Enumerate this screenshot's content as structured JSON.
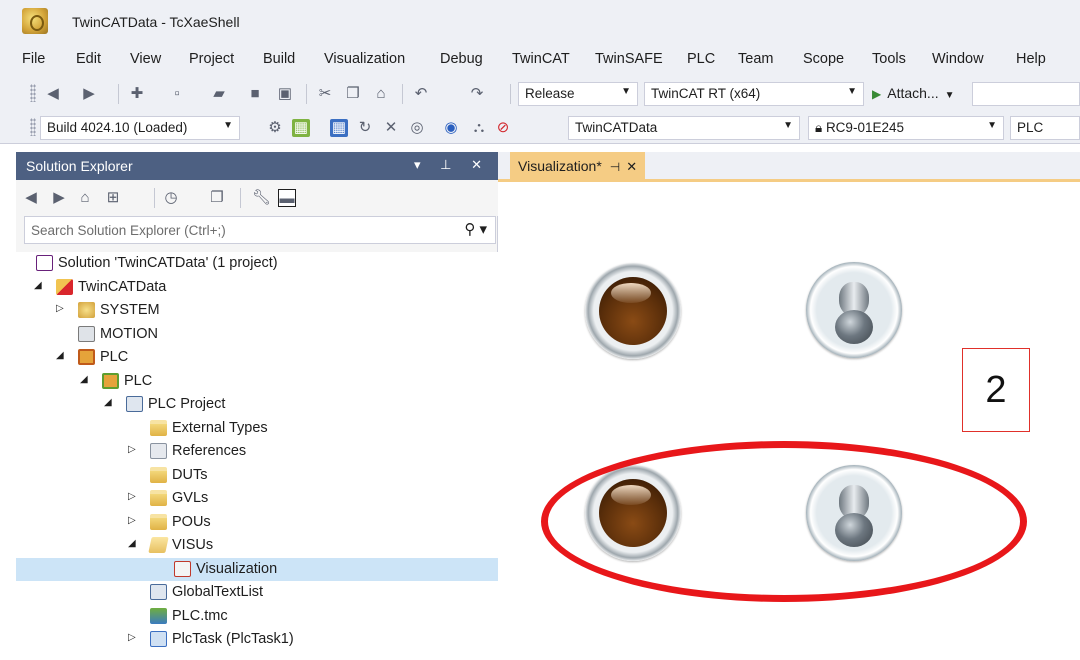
{
  "window": {
    "title": "TwinCATData - TcXaeShell"
  },
  "menu": [
    "File",
    "Edit",
    "View",
    "Project",
    "Build",
    "Visualization",
    "Debug",
    "TwinCAT",
    "TwinSAFE",
    "PLC",
    "Team",
    "Scope",
    "Tools",
    "Window",
    "Help"
  ],
  "toolbar1": {
    "configuration": "Release",
    "platform": "TwinCAT RT (x64)",
    "attach_label": "Attach..."
  },
  "toolbar2": {
    "build": "Build 4024.10 (Loaded)",
    "project": "TwinCATData",
    "target": "RC9-01E245",
    "plc": "PLC"
  },
  "solution_explorer": {
    "title": "Solution Explorer",
    "search_placeholder": "Search Solution Explorer (Ctrl+;)",
    "tree": [
      {
        "label": "Solution 'TwinCATData' (1 project)",
        "icon": "solution-icon"
      },
      {
        "label": "TwinCATData",
        "icon": "twincat-project-icon"
      },
      {
        "label": "SYSTEM",
        "icon": "system-icon"
      },
      {
        "label": "MOTION",
        "icon": "motion-icon"
      },
      {
        "label": "PLC",
        "icon": "plc-icon"
      },
      {
        "label": "PLC",
        "icon": "plc-project-icon"
      },
      {
        "label": "PLC Project",
        "icon": "plc-project-file-icon"
      },
      {
        "label": "External Types",
        "icon": "folder-icon"
      },
      {
        "label": "References",
        "icon": "references-icon"
      },
      {
        "label": "DUTs",
        "icon": "folder-icon"
      },
      {
        "label": "GVLs",
        "icon": "folder-icon"
      },
      {
        "label": "POUs",
        "icon": "folder-icon"
      },
      {
        "label": "VISUs",
        "icon": "folder-open-icon"
      },
      {
        "label": "Visualization",
        "icon": "visualization-icon"
      },
      {
        "label": "GlobalTextList",
        "icon": "textlist-icon"
      },
      {
        "label": "PLC.tmc",
        "icon": "tmc-icon"
      },
      {
        "label": "PlcTask (PlcTask1)",
        "icon": "task-icon"
      }
    ]
  },
  "editor": {
    "tab_label": "Visualization*"
  },
  "annotation": {
    "callout_number": "2",
    "highlight_color": "#e8171a"
  },
  "colors": {
    "panel_header": "#4d6082",
    "active_tab": "#f5cc84",
    "selected_row": "#cce4f7"
  }
}
